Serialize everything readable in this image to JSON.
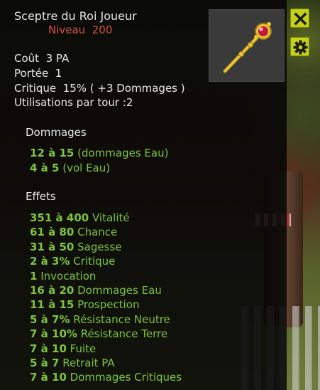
{
  "item": {
    "name": "Sceptre du Roi Joueur",
    "level_label": "Niveau",
    "level_value": "200"
  },
  "stats": {
    "cost_label": "Coût",
    "cost_value": "3 PA",
    "range_label": "Portée",
    "range_value": "1",
    "crit_label": "Critique",
    "crit_value": "15% ( +3 Dommages )",
    "uses_label": "Utilisations par tour :",
    "uses_value": "2"
  },
  "damage": {
    "title": "Dommages",
    "lines": [
      {
        "range": "12 à 15",
        "text": "(dommages Eau)"
      },
      {
        "range": "4 à 5",
        "text": "(vol Eau)"
      }
    ]
  },
  "effects": {
    "title": "Effets",
    "lines": [
      {
        "range": "351 à 400",
        "text": "Vitalité"
      },
      {
        "range": "61 à 80",
        "text": "Chance"
      },
      {
        "range": "31 à 50",
        "text": "Sagesse"
      },
      {
        "range": "2 à 3%",
        "text": "Critique"
      },
      {
        "range": "1",
        "text": "Invocation"
      },
      {
        "range": "16 à 20",
        "text": "Dommages Eau"
      },
      {
        "range": "11 à 15",
        "text": "Prospection"
      },
      {
        "range": "5 à 7%",
        "text": "Résistance Neutre"
      },
      {
        "range": "7 à 10%",
        "text": "Résistance Terre"
      },
      {
        "range": "7 à 10",
        "text": "Fuite"
      },
      {
        "range": "5 à 7",
        "text": "Retrait PA"
      },
      {
        "range": "7 à 10",
        "text": "Dommages Critiques"
      }
    ]
  },
  "buttons": {
    "close_icon": "close-icon",
    "settings_icon": "gear-icon"
  },
  "colors": {
    "accent_green": "#7fc341",
    "level_red": "#d4533f",
    "button_yellow": "#c3d219"
  }
}
